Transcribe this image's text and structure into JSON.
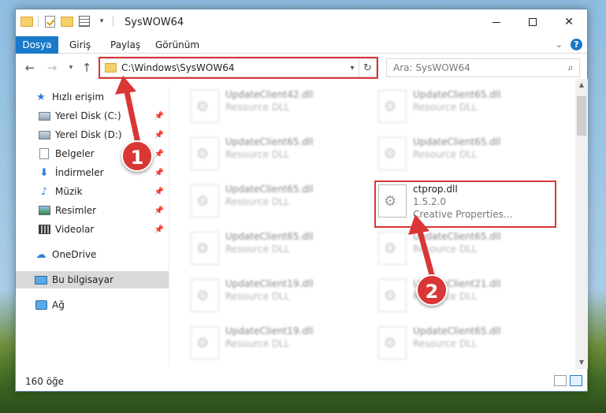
{
  "window": {
    "title": "SysWOW64"
  },
  "ribbon": {
    "tabs": [
      "Dosya",
      "Giriş",
      "Paylaş",
      "Görünüm"
    ],
    "help": "?"
  },
  "nav": {
    "address": "C:\\Windows\\SysWOW64",
    "search_placeholder": "Ara: SysWOW64"
  },
  "sidebar": {
    "items": [
      {
        "label": "Hızlı erişim",
        "icon": "star-icon"
      },
      {
        "label": "Yerel Disk (C:)",
        "icon": "drive-icon",
        "pinned": true
      },
      {
        "label": "Yerel Disk (D:)",
        "icon": "drive-icon",
        "pinned": true
      },
      {
        "label": "Belgeler",
        "icon": "documents-icon",
        "pinned": true
      },
      {
        "label": "İndirmeler",
        "icon": "download-icon",
        "pinned": true
      },
      {
        "label": "Müzik",
        "icon": "music-icon",
        "pinned": true
      },
      {
        "label": "Resimler",
        "icon": "pictures-icon",
        "pinned": true
      },
      {
        "label": "Videolar",
        "icon": "videos-icon",
        "pinned": true
      },
      {
        "label": "OneDrive",
        "icon": "cloud-icon"
      },
      {
        "label": "Bu bilgisayar",
        "icon": "computer-icon",
        "selected": true
      },
      {
        "label": "Ağ",
        "icon": "network-icon"
      }
    ]
  },
  "files": [
    {
      "name": "UpdateClient42.dll",
      "type": "Resource DLL"
    },
    {
      "name": "UpdateClient65.dll",
      "type": "Resource DLL"
    },
    {
      "name": "UpdateClient65.dll",
      "type": "Resource DLL"
    },
    {
      "name": "UpdateClient65.dll",
      "type": "Resource DLL"
    },
    {
      "name": "UpdateClient65.dll",
      "type": "Resource DLL"
    },
    {
      "name": "ctprop.dll",
      "version": "1.5.2.0",
      "desc": "Creative Properties..."
    },
    {
      "name": "UpdateClient65.dll",
      "type": "Resource DLL"
    },
    {
      "name": "UpdateClient65.dll",
      "type": "Resource DLL"
    },
    {
      "name": "UpdateClient19.dll",
      "type": "Resource DLL"
    },
    {
      "name": "UpdateClient21.dll",
      "type": "Resource DLL"
    },
    {
      "name": "UpdateClient19.dll",
      "type": "Resource DLL"
    },
    {
      "name": "UpdateClient65.dll",
      "type": "Resource DLL"
    }
  ],
  "status": {
    "count": "160 öğe"
  },
  "annotations": {
    "badge1": "1",
    "badge2": "2",
    "color": "#d93636"
  }
}
